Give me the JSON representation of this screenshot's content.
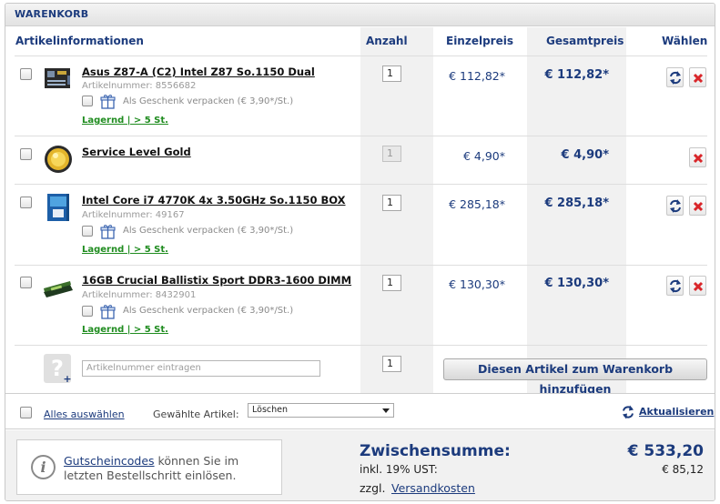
{
  "header": {
    "title": "WARENKORB"
  },
  "columns": {
    "info": "Artikelinformationen",
    "qty": "Anzahl",
    "unit_price": "Einzelpreis",
    "total_price": "Gesamtpreis",
    "choose": "Wählen"
  },
  "items": [
    {
      "name": "Asus Z87-A (C2) Intel Z87 So.1150 Dual",
      "article_label": "Artikelnummer: 8556682",
      "gift_label": "Als Geschenk verpacken (€ 3,90*/St.)",
      "stock": "Lagernd | > 5 St.",
      "qty": "1",
      "unit_price": "€ 112,82*",
      "total_price": "€ 112,82*"
    },
    {
      "name": "Service Level Gold",
      "qty": "1",
      "unit_price": "€ 4,90*",
      "total_price": "€ 4,90*"
    },
    {
      "name": "Intel Core i7 4770K 4x 3.50GHz So.1150 BOX",
      "article_label": "Artikelnummer: 49167",
      "gift_label": "Als Geschenk verpacken (€ 3,90*/St.)",
      "stock": "Lagernd | > 5 St.",
      "qty": "1",
      "unit_price": "€ 285,18*",
      "total_price": "€ 285,18*"
    },
    {
      "name": "16GB Crucial Ballistix Sport DDR3-1600 DIMM",
      "article_label": "Artikelnummer: 8432901",
      "gift_label": "Als Geschenk verpacken (€ 3,90*/St.)",
      "stock": "Lagernd | > 5 St.",
      "qty": "1",
      "unit_price": "€ 130,30*",
      "total_price": "€ 130,30*"
    }
  ],
  "add_row": {
    "placeholder": "Artikelnummer eintragen",
    "qty": "1",
    "button": "Diesen Artikel zum Warenkorb hinzufügen"
  },
  "actions": {
    "select_all": "Alles auswählen",
    "selected_label": "Gewählte Artikel:",
    "selected_action": "Löschen",
    "refresh": "Aktualisieren"
  },
  "voucher": {
    "link": "Gutscheincodes",
    "text_rest": " können Sie im letzten Bestellschritt einlösen."
  },
  "summary": {
    "subtotal_label": "Zwischensumme:",
    "subtotal_value": "€ 533,20",
    "vat_label": "inkl. 19% UST:",
    "vat_value": "€ 85,12",
    "shipping_prefix": "zzgl.",
    "shipping_link": "Versandkosten"
  },
  "colors": {
    "accent": "#1c3b7d",
    "stock": "#1f8c1f",
    "delete": "#d9262a"
  },
  "icons": {
    "refresh": "refresh-arrows-icon",
    "delete": "delete-x-icon",
    "gift": "gift-box-icon",
    "help": "question-mark-icon",
    "info": "info-icon"
  }
}
